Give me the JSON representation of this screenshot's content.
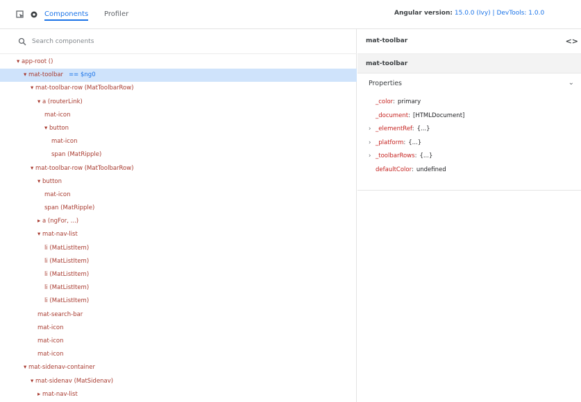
{
  "toolbar": {
    "tabs": [
      {
        "label": "Components",
        "active": true
      },
      {
        "label": "Profiler",
        "active": false
      }
    ],
    "version_label": "Angular version:",
    "version_value": "15.0.0 (Ivy) | DevTools: 1.0.0"
  },
  "search": {
    "placeholder": "Search components"
  },
  "tree": [
    {
      "indent": 0,
      "text": "▾ app-root ()",
      "selected": false
    },
    {
      "indent": 1,
      "text": "▾ mat-toolbar",
      "dir": "== $ng0",
      "selected": true
    },
    {
      "indent": 2,
      "text": "▾ mat-toolbar-row (MatToolbarRow)",
      "selected": false
    },
    {
      "indent": 3,
      "text": "▾ a (routerLink)",
      "selected": false
    },
    {
      "indent": 4,
      "text": "mat-icon",
      "selected": false
    },
    {
      "indent": 4,
      "text": "▾ button",
      "selected": false
    },
    {
      "indent": 5,
      "text": "mat-icon",
      "selected": false
    },
    {
      "indent": 5,
      "text": "span (MatRipple)",
      "selected": false
    },
    {
      "indent": 2,
      "text": "▾ mat-toolbar-row (MatToolbarRow)",
      "selected": false
    },
    {
      "indent": 3,
      "text": "▾ button",
      "selected": false
    },
    {
      "indent": 4,
      "text": "mat-icon",
      "selected": false
    },
    {
      "indent": 4,
      "text": "span (MatRipple)",
      "selected": false
    },
    {
      "indent": 3,
      "text": "▸ a (ngFor, ...)",
      "selected": false
    },
    {
      "indent": 3,
      "text": "▾ mat-nav-list",
      "selected": false
    },
    {
      "indent": 4,
      "text": "li (MatListItem)",
      "selected": false
    },
    {
      "indent": 4,
      "text": "li (MatListItem)",
      "selected": false
    },
    {
      "indent": 4,
      "text": "li (MatListItem)",
      "selected": false
    },
    {
      "indent": 4,
      "text": "li (MatListItem)",
      "selected": false
    },
    {
      "indent": 4,
      "text": "li (MatListItem)",
      "selected": false
    },
    {
      "indent": 3,
      "text": "mat-search-bar",
      "selected": false
    },
    {
      "indent": 3,
      "text": "mat-icon",
      "selected": false
    },
    {
      "indent": 3,
      "text": "mat-icon",
      "selected": false
    },
    {
      "indent": 3,
      "text": "mat-icon",
      "selected": false
    },
    {
      "indent": 1,
      "text": "▾ mat-sidenav-container",
      "selected": false
    },
    {
      "indent": 2,
      "text": "▾ mat-sidenav (MatSidenav)",
      "selected": false
    },
    {
      "indent": 3,
      "text": "▸ mat-nav-list",
      "selected": false
    }
  ],
  "details": {
    "header_title": "mat-toolbar",
    "code_icon": "code-icon",
    "sub_label": "mat-toolbar",
    "section_title": "Properties",
    "props": [
      {
        "key": "_color",
        "value": "primary",
        "expandable": false
      },
      {
        "key": "_document",
        "value": "[HTMLDocument]",
        "expandable": false
      },
      {
        "key": "_elementRef",
        "value": "{...}",
        "expandable": true
      },
      {
        "key": "_platform",
        "value": "{...}",
        "expandable": true
      },
      {
        "key": "_toolbarRows",
        "value": "{...}",
        "expandable": true
      },
      {
        "key": "defaultColor",
        "value": "undefined",
        "expandable": false
      }
    ]
  },
  "colors": {
    "accent": "#1a73e8",
    "selection": "#cfe3fb",
    "tag": "#a83a2f",
    "prop_key": "#c5221f"
  }
}
